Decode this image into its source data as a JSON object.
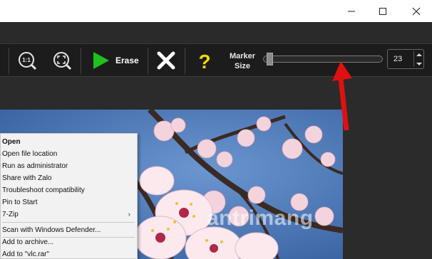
{
  "window": {
    "minimize_icon": "minimize-icon",
    "maximize_icon": "maximize-icon",
    "close_icon": "close-icon"
  },
  "toolbar": {
    "zoom_actual_icon": "1:1",
    "zoom_fit_icon": "fit-icon",
    "erase_label": "Erase",
    "clear_icon": "x-icon",
    "help_icon": "?",
    "marker_size_label_line1": "Marker",
    "marker_size_label_line2": "Size",
    "marker_size_value": "23",
    "marker_size_level": 0.03
  },
  "context_menu": {
    "items": [
      {
        "label": "Open",
        "bold": true
      },
      {
        "label": "Open file location"
      },
      {
        "label": "Run as administrator"
      },
      {
        "label": "Share with Zalo"
      },
      {
        "label": "Troubleshoot compatibility"
      },
      {
        "label": "Pin to Start"
      },
      {
        "label": "7-Zip",
        "submenu": true
      },
      {
        "label": "Scan with Windows Defender..."
      },
      {
        "label": "Add to archive..."
      },
      {
        "label": "Add to \"vlc.rar\""
      }
    ]
  },
  "watermark": {
    "text": "antrimang"
  },
  "colors": {
    "toolbar_bg": "#1c1c1c",
    "erase_green": "#1ec21e",
    "help_yellow": "#f5d800",
    "arrow_red": "#e01010",
    "sky_blue": "#4a79b8"
  }
}
